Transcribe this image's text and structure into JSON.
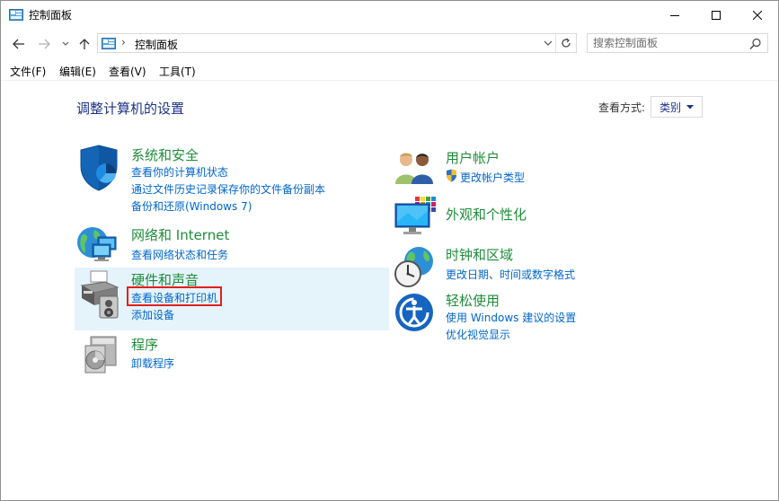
{
  "window": {
    "title": "控制面板"
  },
  "address": {
    "breadcrumb": "控制面板"
  },
  "search": {
    "placeholder": "搜索控制面板"
  },
  "menu": {
    "file": "文件(F)",
    "edit": "编辑(E)",
    "view": "查看(V)",
    "tools": "工具(T)"
  },
  "main": {
    "title": "调整计算机的设置",
    "view_by_label": "查看方式:",
    "view_by_value": "类别"
  },
  "categories_left": [
    {
      "title": "系统和安全",
      "links": [
        "查看你的计算机状态",
        "通过文件历史记录保存你的文件备份副本",
        "备份和还原(Windows 7)"
      ]
    },
    {
      "title": "网络和 Internet",
      "links": [
        "查看网络状态和任务"
      ]
    },
    {
      "title": "硬件和声音",
      "links": [
        "查看设备和打印机",
        "添加设备"
      ]
    },
    {
      "title": "程序",
      "links": [
        "卸载程序"
      ]
    }
  ],
  "categories_right": [
    {
      "title": "用户帐户",
      "links": [
        "更改帐户类型"
      ]
    },
    {
      "title": "外观和个性化",
      "links": []
    },
    {
      "title": "时钟和区域",
      "links": [
        "更改日期、时间或数字格式"
      ]
    },
    {
      "title": "轻松使用",
      "links": [
        "使用 Windows 建议的设置",
        "优化视觉显示"
      ]
    }
  ],
  "colors": {
    "category_title": "#1e8c3a",
    "link": "#0066cc",
    "heading": "#1e3287",
    "highlight_box": "#e0201a",
    "hover_background": "#e5f3fb"
  }
}
